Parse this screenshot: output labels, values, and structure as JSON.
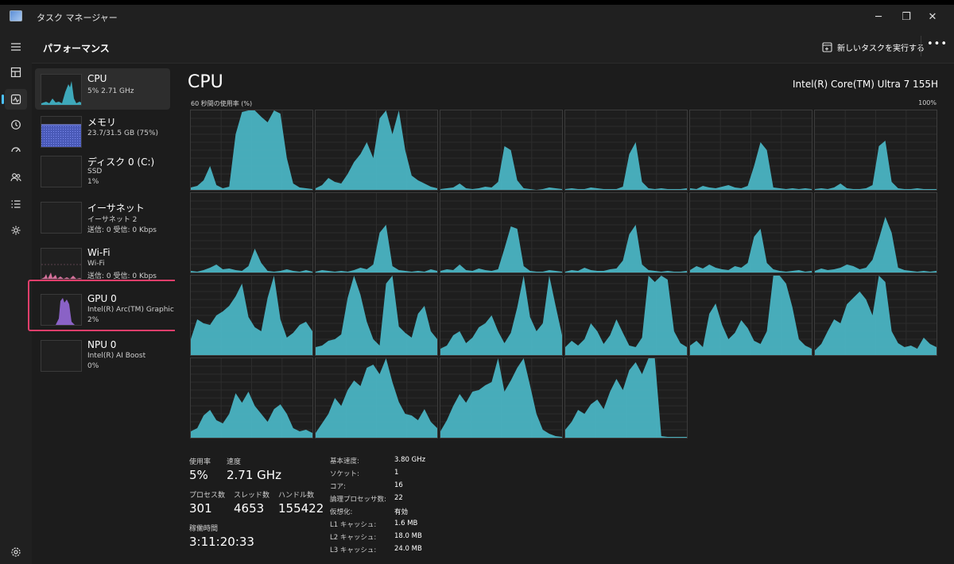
{
  "window": {
    "title": "タスク マネージャー",
    "minimize_icon": "─",
    "maximize_icon": "❐",
    "close_icon": "✕"
  },
  "header": {
    "page_title": "パフォーマンス",
    "run_task_label": "新しいタスクを実行する",
    "more_label": "•••"
  },
  "nav": [
    "hamburger-icon",
    "processes-icon",
    "performance-icon",
    "app-history-icon",
    "startup-icon",
    "users-icon",
    "details-icon",
    "services-icon",
    "settings-icon"
  ],
  "sidebar": {
    "items": [
      {
        "name": "CPU",
        "lines": [
          "5%  2.71 GHz"
        ],
        "color": "#4bb8c8"
      },
      {
        "name": "メモリ",
        "lines": [
          "23.7/31.5 GB (75%)"
        ],
        "color": "#6f7fe0"
      },
      {
        "name": "ディスク 0 (C:)",
        "lines": [
          "SSD",
          "1%"
        ],
        "color": "#5cb85c"
      },
      {
        "name": "イーサネット",
        "lines": [
          "イーサネット 2",
          "送信: 0 受信: 0 Kbps"
        ],
        "color": "#d27c3f"
      },
      {
        "name": "Wi-Fi",
        "lines": [
          "Wi-Fi",
          "送信: 0 受信: 0 Kbps"
        ],
        "color": "#d4709a"
      },
      {
        "name": "GPU 0",
        "lines": [
          "Intel(R) Arc(TM) Graphic",
          "2%"
        ],
        "color": "#9a6fd8"
      },
      {
        "name": "NPU 0",
        "lines": [
          "Intel(R) AI Boost",
          "0%"
        ],
        "color": "#9a6fd8"
      }
    ]
  },
  "main": {
    "title": "CPU",
    "cpu_model": "Intel(R) Core(TM) Ultra 7 155H",
    "graph_label": "60 秒間の使用率 (%)",
    "graph_max": "100%",
    "accent": "#4bb8c8"
  },
  "chart_data": {
    "type": "area",
    "title": "60 秒間の使用率 (%)",
    "ylim": [
      0,
      100
    ],
    "core_count": 22,
    "series": [
      {
        "values": [
          3,
          5,
          12,
          30,
          6,
          2,
          4,
          70,
          98,
          100,
          100,
          92,
          85,
          100,
          96,
          40,
          8,
          3,
          2,
          1
        ]
      },
      {
        "values": [
          2,
          6,
          15,
          10,
          8,
          20,
          35,
          45,
          60,
          40,
          90,
          100,
          70,
          100,
          50,
          18,
          12,
          8,
          4,
          2
        ]
      },
      {
        "values": [
          1,
          2,
          3,
          8,
          2,
          1,
          2,
          4,
          3,
          10,
          55,
          50,
          12,
          2,
          1,
          0,
          1,
          3,
          2,
          1
        ]
      },
      {
        "values": [
          1,
          2,
          1,
          1,
          3,
          2,
          1,
          1,
          1,
          4,
          45,
          60,
          10,
          2,
          1,
          2,
          1,
          1,
          1,
          2
        ]
      },
      {
        "values": [
          2,
          1,
          5,
          3,
          2,
          4,
          6,
          3,
          2,
          5,
          30,
          60,
          50,
          3,
          2,
          1,
          2,
          1,
          2,
          1
        ]
      },
      {
        "values": [
          1,
          2,
          1,
          3,
          8,
          2,
          1,
          1,
          2,
          6,
          55,
          62,
          10,
          2,
          1,
          1,
          2,
          1,
          1,
          1
        ]
      },
      {
        "values": [
          2,
          1,
          3,
          6,
          10,
          4,
          5,
          3,
          2,
          8,
          30,
          12,
          2,
          1,
          2,
          4,
          2,
          1,
          3,
          1
        ]
      },
      {
        "values": [
          1,
          3,
          2,
          1,
          2,
          1,
          3,
          6,
          4,
          10,
          50,
          60,
          8,
          3,
          2,
          1,
          2,
          1,
          4,
          2
        ]
      },
      {
        "values": [
          2,
          4,
          3,
          10,
          3,
          2,
          5,
          3,
          2,
          4,
          30,
          58,
          55,
          8,
          2,
          1,
          1,
          3,
          2,
          1
        ]
      },
      {
        "values": [
          1,
          3,
          2,
          6,
          3,
          2,
          2,
          4,
          5,
          15,
          48,
          60,
          10,
          3,
          2,
          1,
          2,
          1,
          1,
          2
        ]
      },
      {
        "values": [
          3,
          8,
          5,
          10,
          6,
          4,
          3,
          8,
          6,
          12,
          45,
          55,
          12,
          4,
          2,
          1,
          2,
          3,
          1,
          2
        ]
      },
      {
        "values": [
          2,
          5,
          3,
          4,
          6,
          10,
          8,
          4,
          6,
          16,
          42,
          70,
          50,
          6,
          3,
          2,
          1,
          2,
          1,
          2
        ]
      },
      {
        "values": [
          20,
          45,
          40,
          38,
          50,
          55,
          62,
          74,
          90,
          48,
          35,
          30,
          72,
          100,
          45,
          22,
          28,
          38,
          42,
          30
        ]
      },
      {
        "values": [
          10,
          12,
          18,
          20,
          26,
          72,
          100,
          76,
          42,
          20,
          12,
          90,
          100,
          36,
          28,
          22,
          52,
          62,
          30,
          20
        ]
      },
      {
        "values": [
          8,
          12,
          25,
          30,
          15,
          22,
          35,
          40,
          50,
          30,
          15,
          28,
          60,
          100,
          48,
          30,
          40,
          100,
          62,
          25
        ]
      },
      {
        "values": [
          10,
          18,
          12,
          20,
          40,
          30,
          14,
          25,
          45,
          28,
          12,
          10,
          22,
          100,
          92,
          100,
          95,
          30,
          15,
          10
        ]
      },
      {
        "values": [
          12,
          18,
          10,
          52,
          65,
          38,
          20,
          28,
          44,
          34,
          18,
          14,
          30,
          100,
          100,
          90,
          60,
          20,
          12,
          8
        ]
      },
      {
        "values": [
          6,
          14,
          30,
          45,
          40,
          64,
          72,
          80,
          70,
          50,
          100,
          92,
          30,
          15,
          10,
          12,
          8,
          22,
          14,
          10
        ]
      },
      {
        "values": [
          8,
          12,
          28,
          35,
          22,
          18,
          30,
          56,
          44,
          58,
          40,
          30,
          20,
          36,
          42,
          30,
          12,
          8,
          10,
          6
        ]
      },
      {
        "values": [
          6,
          18,
          30,
          50,
          40,
          60,
          72,
          65,
          88,
          92,
          80,
          100,
          70,
          45,
          30,
          28,
          22,
          36,
          20,
          12
        ]
      },
      {
        "values": [
          8,
          22,
          40,
          55,
          44,
          58,
          60,
          66,
          70,
          100,
          58,
          72,
          88,
          100,
          66,
          30,
          10,
          5,
          2,
          1
        ]
      },
      {
        "values": [
          10,
          20,
          35,
          30,
          42,
          48,
          36,
          58,
          74,
          60,
          85,
          95,
          80,
          100,
          100,
          2,
          1,
          1,
          1,
          1
        ]
      }
    ]
  },
  "stats": {
    "utilization_label": "使用率",
    "utilization": "5%",
    "speed_label": "速度",
    "speed": "2.71 GHz",
    "processes_label": "プロセス数",
    "processes": "301",
    "threads_label": "スレッド数",
    "threads": "4653",
    "handles_label": "ハンドル数",
    "handles": "155422",
    "uptime_label": "稼働時間",
    "uptime": "3:11:20:33"
  },
  "specs": [
    {
      "key": "基本速度:",
      "value": "3.80 GHz"
    },
    {
      "key": "ソケット:",
      "value": "1"
    },
    {
      "key": "コア:",
      "value": "16"
    },
    {
      "key": "論理プロセッサ数:",
      "value": "22"
    },
    {
      "key": "仮想化:",
      "value": "有効"
    },
    {
      "key": "L1 キャッシュ:",
      "value": "1.6 MB"
    },
    {
      "key": "L2 キャッシュ:",
      "value": "18.0 MB"
    },
    {
      "key": "L3 キャッシュ:",
      "value": "24.0 MB"
    }
  ]
}
